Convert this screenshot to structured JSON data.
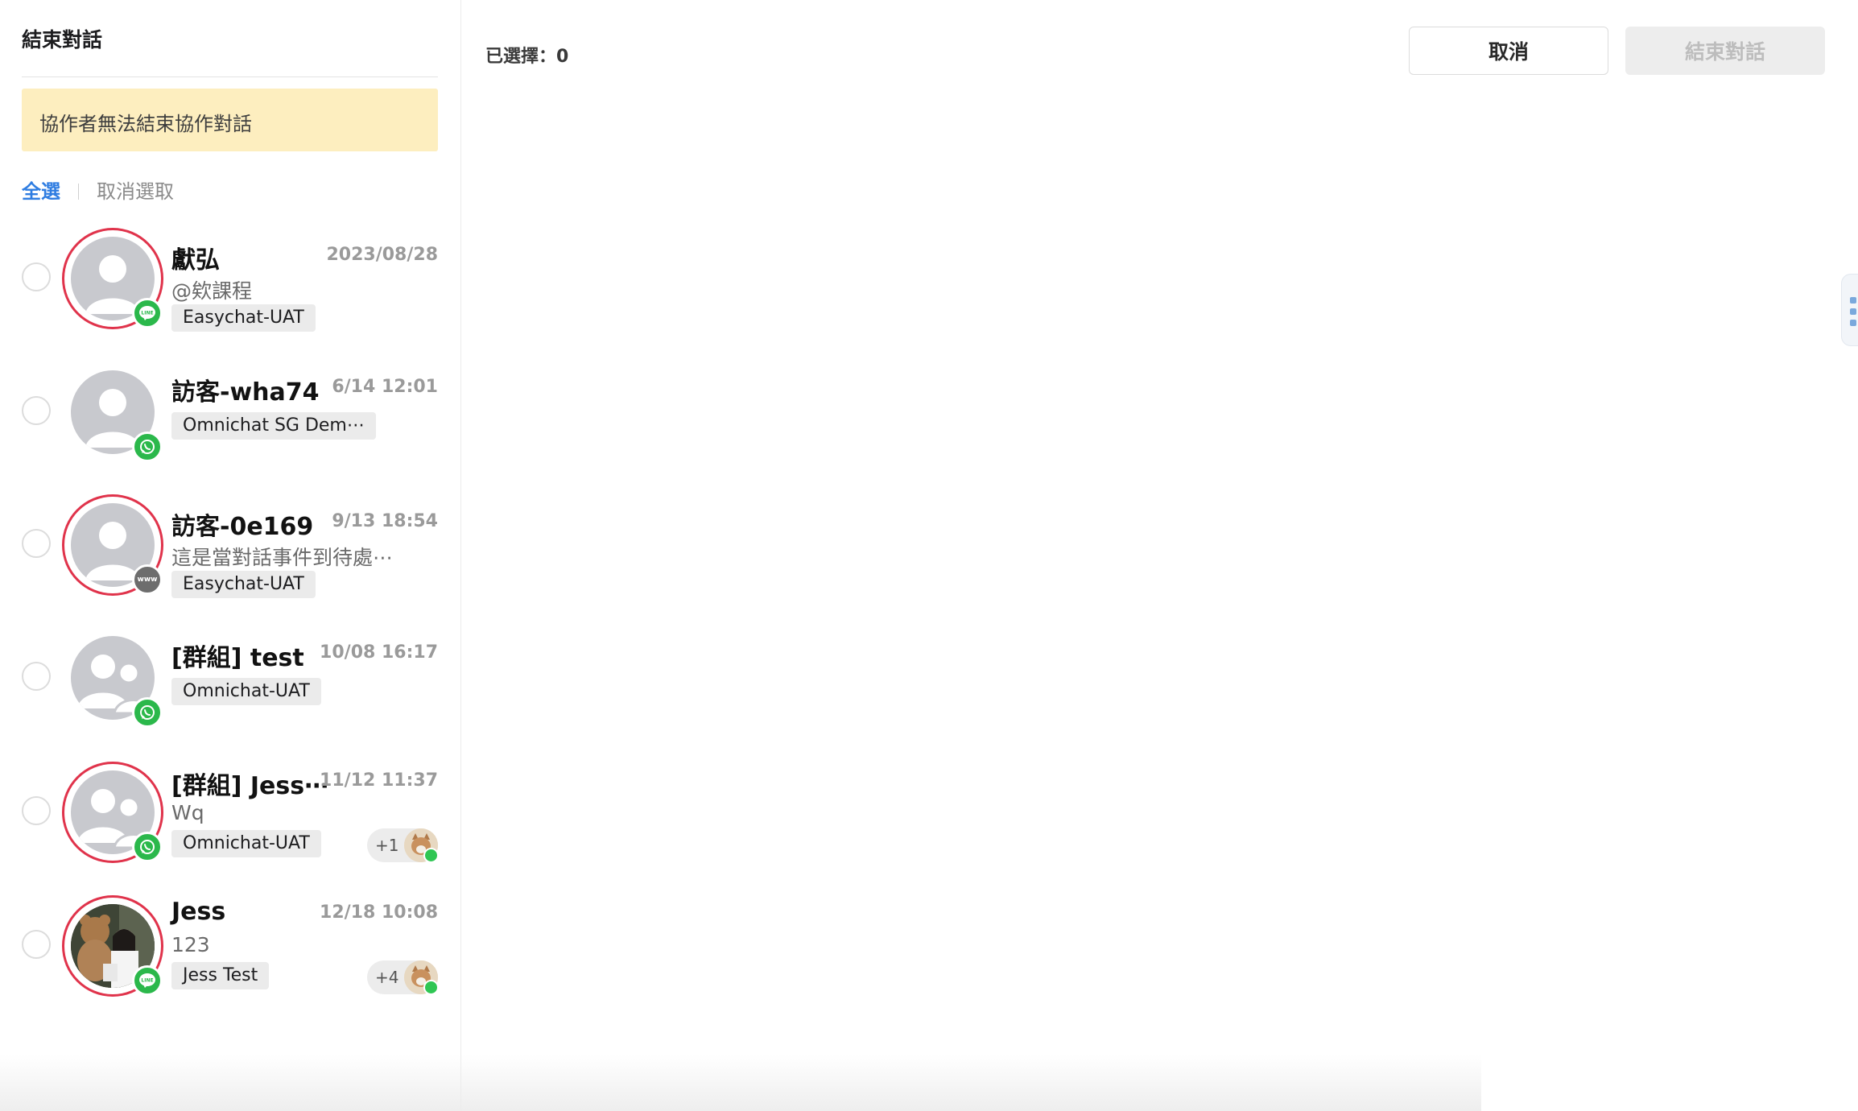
{
  "panel": {
    "title": "結束對話",
    "notice": "協作者無法結束協作對話",
    "select_all": "全選",
    "deselect": "取消選取"
  },
  "header": {
    "selected_label": "已選擇：0",
    "cancel": "取消",
    "end_conversation": "結束對話"
  },
  "conversations": [
    {
      "name": "獻弘",
      "time": "2023/08/28",
      "preview": "@欸課程",
      "tag": "Easychat-UAT",
      "channel": "line-icon",
      "ring": true
    },
    {
      "name": "訪客-wha74",
      "time": "6/14 12:01",
      "preview": "",
      "tag": "Omnichat SG Dem⋯",
      "channel": "whatsapp-icon",
      "ring": false
    },
    {
      "name": "訪客-0e169",
      "time": "9/13 18:54",
      "preview": "這是當對話事件到待處⋯",
      "tag": "Easychat-UAT",
      "channel": "www-icon",
      "channel_text": "www",
      "ring": true
    },
    {
      "name": "[群組] test",
      "time": "10/08 16:17",
      "preview": "",
      "tag": "Omnichat-UAT",
      "channel": "whatsapp-icon",
      "ring": false
    },
    {
      "name": "[群組] Jess⋯",
      "time": "11/12 11:37",
      "preview": "Wq",
      "tag": "Omnichat-UAT",
      "channel": "whatsapp-icon",
      "ring": true,
      "collaborators": "+1"
    },
    {
      "name": "Jess",
      "time": "12/18 10:08",
      "preview": "123",
      "tag": "Jess Test",
      "channel": "line-icon",
      "ring": true,
      "collaborators": "+4"
    }
  ],
  "colors": {
    "accent": "#2f7de1",
    "ring": "#e0334b",
    "notice_bg": "#fdeebf",
    "online": "#2fc653"
  }
}
